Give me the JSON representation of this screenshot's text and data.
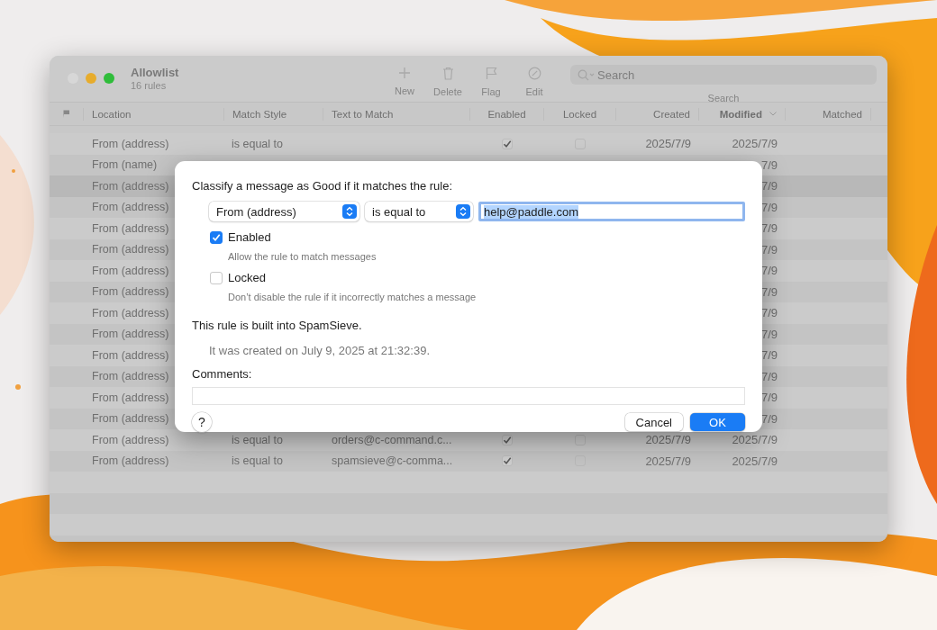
{
  "window": {
    "title": "Allowlist",
    "subtitle": "16 rules"
  },
  "toolbar": [
    {
      "kind": "plus",
      "label": "New"
    },
    {
      "kind": "trash",
      "label": "Delete"
    },
    {
      "kind": "flag",
      "label": "Flag"
    },
    {
      "kind": "edit",
      "label": "Edit"
    }
  ],
  "search": {
    "placeholder": "Search",
    "label": "Search"
  },
  "table": {
    "columns": [
      {
        "kind": "flag"
      },
      {
        "label": "Location"
      },
      {
        "label": "Match Style"
      },
      {
        "label": "Text to Match"
      },
      {
        "label": "Enabled"
      },
      {
        "label": "Locked"
      },
      {
        "label": "Created"
      },
      {
        "label": "Modified",
        "sorted": true
      },
      {
        "label": "Matched"
      }
    ],
    "rows": [
      {
        "location": "From (address)",
        "match_style": "is equal to",
        "enabled": true,
        "locked": false,
        "created": "2025/7/9",
        "modified": "2025/7/9",
        "selected": false
      },
      {
        "location": "From (name)",
        "modified": "7/9",
        "selected": false
      },
      {
        "location": "From (address)",
        "modified": "7/9",
        "selected": true
      },
      {
        "location": "From (address)",
        "modified": "7/9",
        "selected": false
      },
      {
        "location": "From (address)",
        "modified": "7/9",
        "selected": false
      },
      {
        "location": "From (address)",
        "modified": "7/9",
        "selected": false
      },
      {
        "location": "From (address)",
        "modified": "7/9",
        "selected": false
      },
      {
        "location": "From (address)",
        "modified": "7/9",
        "selected": false
      },
      {
        "location": "From (address)",
        "modified": "7/9",
        "selected": false
      },
      {
        "location": "From (address)",
        "modified": "7/9",
        "selected": false
      },
      {
        "location": "From (address)",
        "modified": "7/9",
        "selected": false
      },
      {
        "location": "From (address)",
        "modified": "7/9",
        "selected": false
      },
      {
        "location": "From (address)",
        "modified": "7/9",
        "selected": false
      },
      {
        "location": "From (address)",
        "modified": "7/9",
        "selected": false
      },
      {
        "location": "From (address)",
        "match_style": "is equal to",
        "text": "orders@c-command.c...",
        "enabled": true,
        "locked": false,
        "created": "2025/7/9",
        "modified": "2025/7/9",
        "selected": false
      },
      {
        "location": "From (address)",
        "match_style": "is equal to",
        "text": "spamsieve@c-comma...",
        "enabled": true,
        "locked": false,
        "created": "2025/7/9",
        "modified": "2025/7/9",
        "selected": false
      }
    ]
  },
  "dialog": {
    "heading": "Classify a message as Good if it matches the rule:",
    "location": "From (address)",
    "match_style": "is equal to",
    "text": "help@paddle.com",
    "options": [
      {
        "label": "Enabled",
        "checked": true,
        "hint": "Allow the rule to match messages"
      },
      {
        "label": "Locked",
        "checked": false,
        "hint": "Don’t disable the rule if it incorrectly matches a message"
      }
    ],
    "built_in": "This rule is built into SpamSieve.",
    "created_note": "It was created on July 9, 2025 at 21:32:39.",
    "comments_label": "Comments:",
    "help": "?",
    "buttons": [
      {
        "label": "Cancel",
        "kind": "cancel"
      },
      {
        "label": "OK",
        "kind": "default"
      }
    ]
  }
}
